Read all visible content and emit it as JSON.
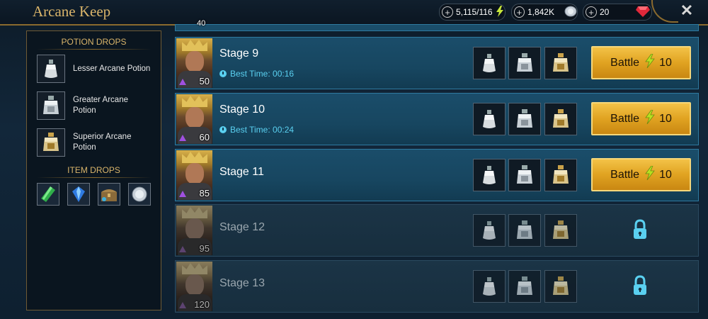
{
  "header": {
    "title": "Arcane Keep",
    "energy": "5,115/116",
    "silver": "1,842K",
    "gems": "20",
    "close": "✕"
  },
  "sidebar": {
    "potion_drops_title": "POTION DROPS",
    "potions": [
      {
        "label": "Lesser Arcane Potion",
        "icon": "lesser-arcane-potion-icon"
      },
      {
        "label": "Greater Arcane Potion",
        "icon": "greater-arcane-potion-icon"
      },
      {
        "label": "Superior Arcane Potion",
        "icon": "superior-arcane-potion-icon"
      }
    ],
    "item_drops_title": "ITEM DROPS",
    "items": [
      "green-artifact-icon",
      "blue-artifact-icon",
      "chest-icon",
      "silver-coin-icon"
    ]
  },
  "stages": [
    {
      "name": "Stage 9",
      "level": "50",
      "best_time": "Best Time: 00:16",
      "locked": false,
      "battle_label": "Battle",
      "cost": "10"
    },
    {
      "name": "Stage 10",
      "level": "60",
      "best_time": "Best Time: 00:24",
      "locked": false,
      "battle_label": "Battle",
      "cost": "10"
    },
    {
      "name": "Stage 11",
      "level": "85",
      "best_time": "",
      "locked": false,
      "battle_label": "Battle",
      "cost": "10"
    },
    {
      "name": "Stage 12",
      "level": "95",
      "best_time": "",
      "locked": true
    },
    {
      "name": "Stage 13",
      "level": "120",
      "best_time": "",
      "locked": true
    }
  ],
  "peek_top_level": "40",
  "colors": {
    "gold": "#d9b46a",
    "accent_blue": "#5ad0f0",
    "button": "#e0a321"
  }
}
